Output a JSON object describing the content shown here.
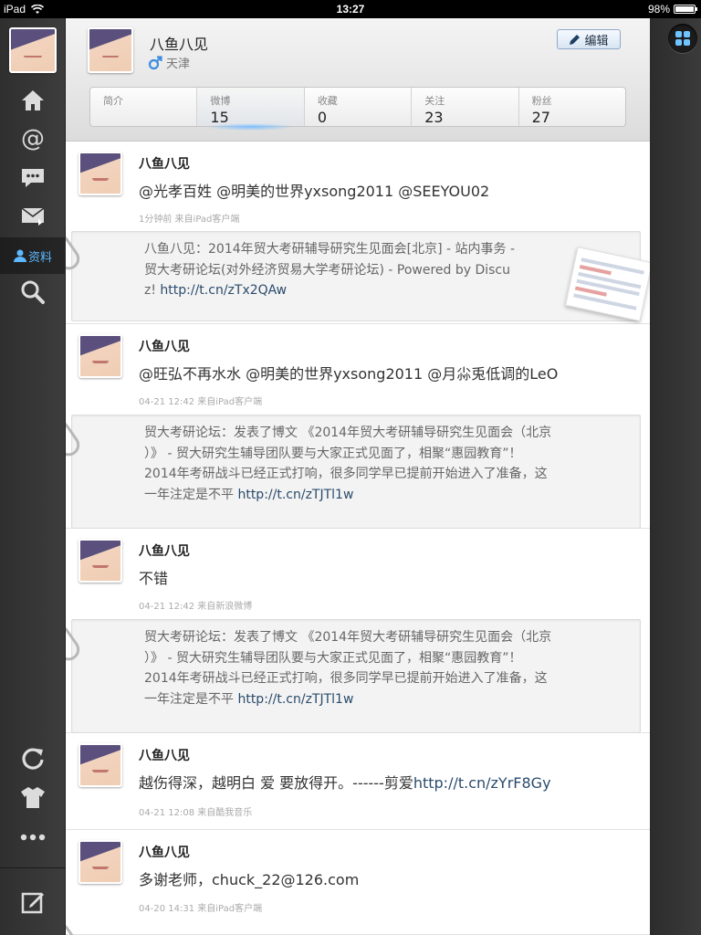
{
  "status": {
    "device": "iPad",
    "time": "13:27",
    "battery": "98%",
    "battery_level": 0.98
  },
  "nav": {
    "items": [
      {
        "icon": "home-icon",
        "label": ""
      },
      {
        "icon": "at-mention-icon",
        "label": ""
      },
      {
        "icon": "comment-icon",
        "label": ""
      },
      {
        "icon": "mail-icon",
        "label": ""
      },
      {
        "icon": "profile-icon",
        "label": "资料",
        "active": true
      },
      {
        "icon": "search-icon",
        "label": ""
      },
      {
        "icon": "refresh-icon",
        "label": ""
      },
      {
        "icon": "shirt-icon",
        "label": ""
      },
      {
        "icon": "more-icon",
        "label": ""
      },
      {
        "icon": "compose-icon",
        "label": ""
      }
    ]
  },
  "profile": {
    "name": "八鱼八见",
    "gender_icon": "male-icon",
    "location": "天津",
    "edit_label": "编辑"
  },
  "stats": [
    {
      "label": "简介",
      "value": ""
    },
    {
      "label": "微博",
      "value": "15",
      "active": true
    },
    {
      "label": "收藏",
      "value": "0"
    },
    {
      "label": "关注",
      "value": "23"
    },
    {
      "label": "粉丝",
      "value": "27"
    }
  ],
  "posts": [
    {
      "name": "八鱼八见",
      "text": "@光孝百姓 @明美的世界yxsong2011 @SEEYOU02",
      "meta": "1分钟前  来自iPad客户端",
      "repost": {
        "lines": [
          "八鱼八见：2014年贸大考研辅导研究生见面会[北京] - 站内事务 -",
          "贸大考研论坛(对外经济贸易大学考研论坛) - Powered by Discu"
        ],
        "last_prefix": "z! ",
        "link": "http://t.cn/zTx2QAw",
        "has_thumb": true
      }
    },
    {
      "name": "八鱼八见",
      "text": "@旺弘不再水水 @明美的世界yxsong2011 @月尛兎低调的LeO",
      "meta": "04-21 12:42  来自iPad客户端",
      "repost": {
        "lines": [
          "贸大考研论坛：发表了博文 《2014年贸大考研辅导研究生见面会（北京",
          "）》 - 贸大研究生辅导团队要与大家正式见面了，相聚“惠园教育”！",
          "2014年考研战斗已经正式打响，很多同学早已提前开始进入了准备，这"
        ],
        "last_prefix": "一年注定是不平 ",
        "link": "http://t.cn/zTJTl1w",
        "has_thumb": false
      }
    },
    {
      "name": "八鱼八见",
      "text": "不错",
      "meta": "04-21 12:42  来自新浪微博",
      "repost": {
        "lines": [
          "贸大考研论坛：发表了博文 《2014年贸大考研辅导研究生见面会（北京",
          "）》 - 贸大研究生辅导团队要与大家正式见面了，相聚“惠园教育”！",
          "2014年考研战斗已经正式打响，很多同学早已提前开始进入了准备，这"
        ],
        "last_prefix": "一年注定是不平 ",
        "link": "http://t.cn/zTJTl1w",
        "has_thumb": false
      }
    },
    {
      "name": "八鱼八见",
      "text": "越伤得深，越明白  爱  要放得开。------剪爱",
      "text_link": "http://t.cn/zYrF8Gy",
      "meta": "04-21 12:08  来自酷我音乐"
    },
    {
      "name": "八鱼八见",
      "text": "多谢老师，chuck_22@126.com",
      "meta": "04-20 14:31  来自iPad客户端"
    }
  ]
}
